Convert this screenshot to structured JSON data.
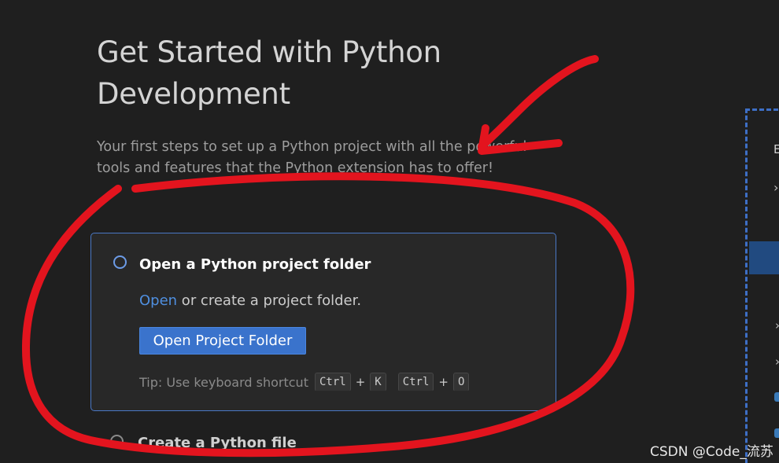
{
  "page": {
    "title": "Get Started with Python Development",
    "subtitle": "Your first steps to set up a Python project with all the powerful tools and features that the Python extension has to offer!"
  },
  "step1": {
    "title": "Open a Python project folder",
    "desc_link": "Open",
    "desc_rest": " or create a project folder.",
    "button_label": "Open Project Folder",
    "tip_label": "Tip: Use keyboard shortcut",
    "keys": [
      "Ctrl",
      "K",
      "Ctrl",
      "O"
    ],
    "plus": "+"
  },
  "step2": {
    "title": "Create a Python file"
  },
  "side_panel": {
    "label_fragment": "E"
  },
  "watermark": "CSDN @Code_流苏",
  "colors": {
    "background": "#1f1f1f",
    "accent": "#3a73cc",
    "card_border": "#4a78c5",
    "annotation_red": "#e3141e"
  },
  "icons": {
    "radio": "radio-circle-icon",
    "chevron": "chevron-right-icon",
    "python_file": "python-file-icon"
  }
}
